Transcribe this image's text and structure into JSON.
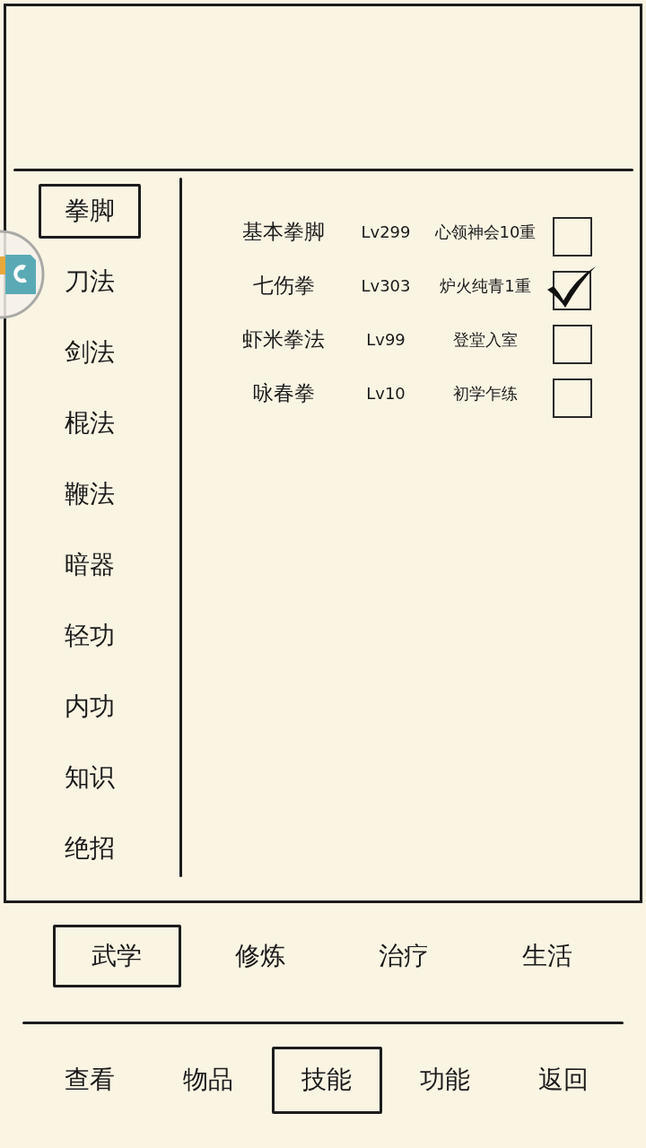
{
  "categories": [
    {
      "label": "拳脚",
      "selected": true
    },
    {
      "label": "刀法",
      "selected": false
    },
    {
      "label": "剑法",
      "selected": false
    },
    {
      "label": "棍法",
      "selected": false
    },
    {
      "label": "鞭法",
      "selected": false
    },
    {
      "label": "暗器",
      "selected": false
    },
    {
      "label": "轻功",
      "selected": false
    },
    {
      "label": "内功",
      "selected": false
    },
    {
      "label": "知识",
      "selected": false
    },
    {
      "label": "绝招",
      "selected": false
    }
  ],
  "skills": [
    {
      "name": "基本拳脚",
      "level": "Lv299",
      "realm": "心领神会10重",
      "checked": false
    },
    {
      "name": "七伤拳",
      "level": "Lv303",
      "realm": "炉火纯青1重",
      "checked": true
    },
    {
      "name": "虾米拳法",
      "level": "Lv99",
      "realm": "登堂入室",
      "checked": false
    },
    {
      "name": "咏春拳",
      "level": "Lv10",
      "realm": "初学乍练",
      "checked": false
    }
  ],
  "tabs": [
    {
      "label": "武学",
      "selected": true
    },
    {
      "label": "修炼",
      "selected": false
    },
    {
      "label": "治疗",
      "selected": false
    },
    {
      "label": "生活",
      "selected": false
    }
  ],
  "nav": [
    {
      "label": "查看",
      "selected": false
    },
    {
      "label": "物品",
      "selected": false
    },
    {
      "label": "技能",
      "selected": true
    },
    {
      "label": "功能",
      "selected": false
    },
    {
      "label": "返回",
      "selected": false
    }
  ]
}
